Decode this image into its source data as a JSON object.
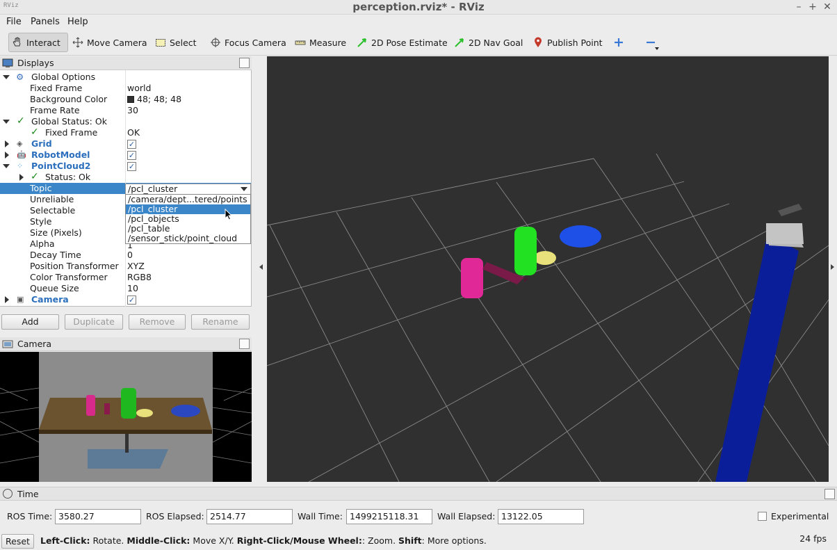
{
  "window": {
    "title": "perception.rviz* - RViz",
    "logo": "RViz"
  },
  "menubar": {
    "items": [
      "File",
      "Panels",
      "Help"
    ]
  },
  "toolbar": {
    "interact": "Interact",
    "move_camera": "Move Camera",
    "select": "Select",
    "focus_camera": "Focus Camera",
    "measure": "Measure",
    "pose_estimate": "2D Pose Estimate",
    "nav_goal": "2D Nav Goal",
    "publish_point": "Publish Point"
  },
  "displays": {
    "title": "Displays",
    "global_options": "Global Options",
    "fixed_frame_label": "Fixed Frame",
    "fixed_frame_value": "world",
    "background_color_label": "Background Color",
    "background_color_value": "48; 48; 48",
    "frame_rate_label": "Frame Rate",
    "frame_rate_value": "30",
    "global_status": "Global Status: Ok",
    "status_fixed_frame_label": "Fixed Frame",
    "status_fixed_frame_value": "OK",
    "grid": "Grid",
    "robot_model": "RobotModel",
    "pointcloud": "PointCloud2",
    "status_ok": "Status: Ok",
    "topic_label": "Topic",
    "topic_value": "/pcl_cluster",
    "unreliable_label": "Unreliable",
    "selectable_label": "Selectable",
    "style_label": "Style",
    "size_label": "Size (Pixels)",
    "alpha_label": "Alpha",
    "alpha_value": "1",
    "decay_label": "Decay Time",
    "decay_value": "0",
    "pos_transformer_label": "Position Transformer",
    "pos_transformer_value": "XYZ",
    "color_transformer_label": "Color Transformer",
    "color_transformer_value": "RGB8",
    "queue_label": "Queue Size",
    "queue_value": "10",
    "camera": "Camera",
    "topic_options": [
      "/camera/dept...tered/points",
      "/pcl_cluster",
      "/pcl_objects",
      "/pcl_table",
      "/sensor_stick/point_cloud"
    ],
    "buttons": {
      "add": "Add",
      "duplicate": "Duplicate",
      "remove": "Remove",
      "rename": "Rename"
    }
  },
  "camera_panel": {
    "title": "Camera"
  },
  "time_panel": {
    "title": "Time",
    "ros_time_label": "ROS Time:",
    "ros_time": "3580.27",
    "ros_elapsed_label": "ROS Elapsed:",
    "ros_elapsed": "2514.77",
    "wall_time_label": "Wall Time:",
    "wall_time": "1499215118.31",
    "wall_elapsed_label": "Wall Elapsed:",
    "wall_elapsed": "13122.05",
    "experimental": "Experimental"
  },
  "statusbar": {
    "reset": "Reset",
    "left_click": "Left-Click:",
    "left_click_desc": "Rotate.",
    "middle_click": "Middle-Click:",
    "middle_click_desc": "Move X/Y.",
    "right_click": "Right-Click/Mouse Wheel:",
    "right_click_desc": ": Zoom.",
    "shift": "Shift",
    "shift_desc": ": More options.",
    "fps": "24 fps"
  },
  "colors": {
    "selection": "#3b86c9",
    "view_bg": "#303030",
    "link_blue": "#2b6fbd",
    "ok_green": "#1b8a1b"
  }
}
